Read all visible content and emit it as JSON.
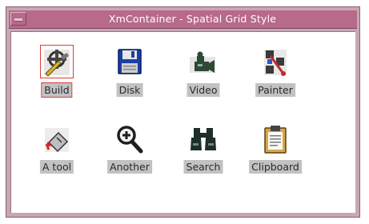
{
  "window": {
    "title": "XmContainer - Spatial Grid Style"
  },
  "icons": [
    {
      "label": "Build",
      "icon": "build-tools-icon",
      "selected": true
    },
    {
      "label": "Disk",
      "icon": "floppy-disk-icon"
    },
    {
      "label": "Video",
      "icon": "video-camera-icon"
    },
    {
      "label": "Painter",
      "icon": "painter-icon"
    },
    {
      "label": "A tool",
      "icon": "paint-bucket-icon"
    },
    {
      "label": "Another",
      "icon": "magnifier-icon"
    },
    {
      "label": "Search",
      "icon": "binoculars-icon"
    },
    {
      "label": "Clipboard",
      "icon": "clipboard-icon"
    }
  ]
}
